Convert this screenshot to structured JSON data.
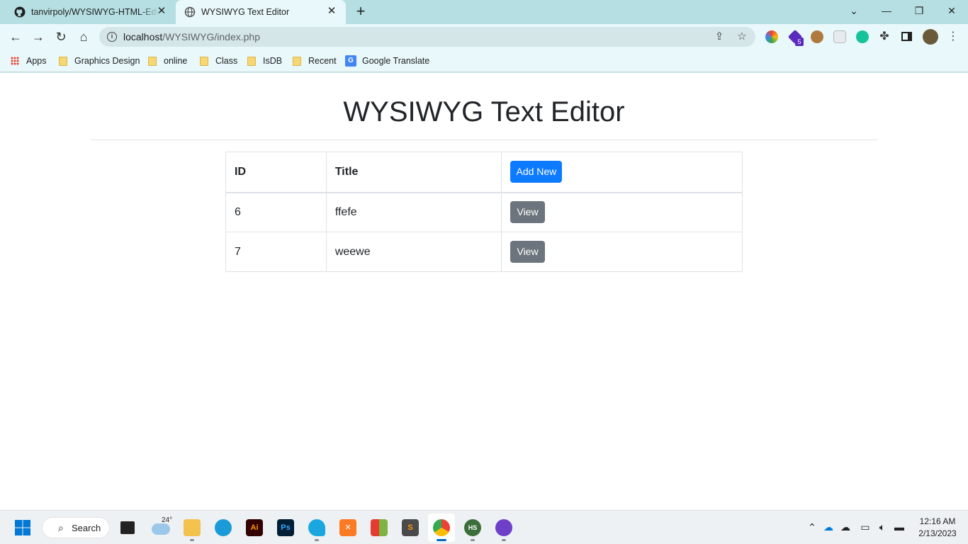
{
  "browser": {
    "tabs": [
      {
        "title": "tanvirpoly/WYSIWYG-HTML-Editor",
        "active": false
      },
      {
        "title": "WYSIWYG Text Editor",
        "active": true
      }
    ],
    "window_controls": {
      "chevron": "⌄",
      "minimize": "—",
      "restore": "❐",
      "close": "✕"
    },
    "address": {
      "host": "localhost",
      "path": "/WYSIWYG/index.php"
    },
    "bookmarks": [
      {
        "label": "Apps",
        "icon": "apps-grid-icon"
      },
      {
        "label": "Graphics Design",
        "icon": "folder-icon"
      },
      {
        "label": "online",
        "icon": "folder-icon"
      },
      {
        "label": "Class",
        "icon": "folder-icon"
      },
      {
        "label": "IsDB",
        "icon": "folder-icon"
      },
      {
        "label": "Recent",
        "icon": "folder-icon"
      },
      {
        "label": "Google Translate",
        "icon": "google-translate-icon"
      }
    ],
    "extension_badge": "5"
  },
  "page": {
    "heading": "WYSIWYG Text Editor",
    "table": {
      "headers": [
        "ID",
        "Title"
      ],
      "add_button": "Add New",
      "rows": [
        {
          "id": "6",
          "title": "ffefe",
          "action": "View"
        },
        {
          "id": "7",
          "title": "weewe",
          "action": "View"
        }
      ]
    },
    "colors": {
      "primary": "#0d7bff",
      "secondary": "#6c757d",
      "text": "#212529"
    }
  },
  "taskbar": {
    "search_label": "Search",
    "weather_temp": "24°",
    "clock": {
      "time": "12:16 AM",
      "date": "2/13/2023"
    }
  }
}
